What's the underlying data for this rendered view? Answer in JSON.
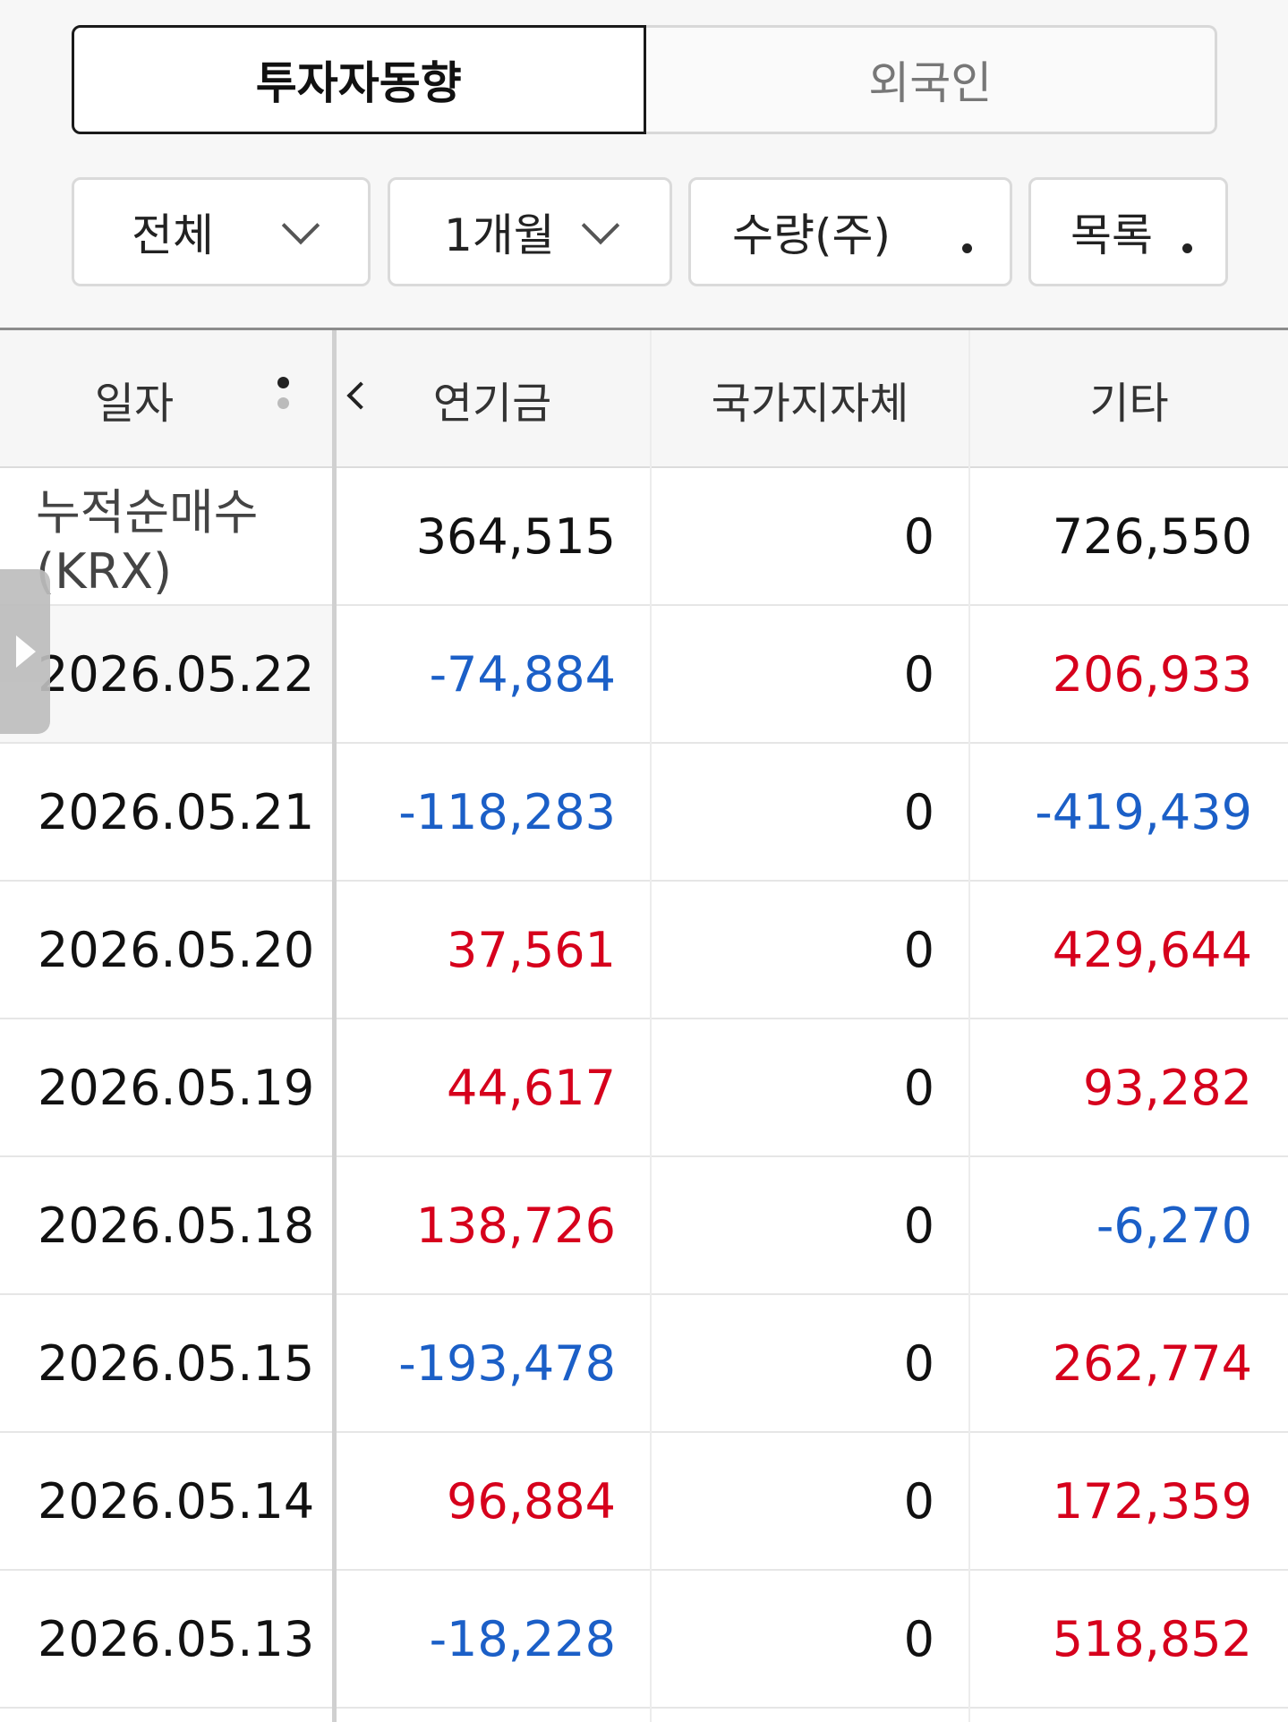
{
  "segment": {
    "active_label": "투자자동향",
    "inactive_label": "외국인"
  },
  "filters": {
    "scope": "전체",
    "period": "1개월",
    "unit": "수량(주)",
    "view": "목록"
  },
  "table": {
    "headers": {
      "date": "일자",
      "nps": "연기금",
      "gov": "국가지자체",
      "etc": "기타"
    },
    "summary": {
      "label": "누적순매수(KRX)",
      "nps": "364,515",
      "gov": "0",
      "etc": "726,550"
    },
    "rows": [
      {
        "date": "2026.05.22",
        "nps": "-74,884",
        "gov": "0",
        "etc": "206,933"
      },
      {
        "date": "2026.05.21",
        "nps": "-118,283",
        "gov": "0",
        "etc": "-419,439"
      },
      {
        "date": "2026.05.20",
        "nps": "37,561",
        "gov": "0",
        "etc": "429,644"
      },
      {
        "date": "2026.05.19",
        "nps": "44,617",
        "gov": "0",
        "etc": "93,282"
      },
      {
        "date": "2026.05.18",
        "nps": "138,726",
        "gov": "0",
        "etc": "-6,270"
      },
      {
        "date": "2026.05.15",
        "nps": "-193,478",
        "gov": "0",
        "etc": "262,774"
      },
      {
        "date": "2026.05.14",
        "nps": "96,884",
        "gov": "0",
        "etc": "172,359"
      },
      {
        "date": "2026.05.13",
        "nps": "-18,228",
        "gov": "0",
        "etc": "518,852"
      }
    ]
  },
  "colors": {
    "positive": "#d6001c",
    "negative": "#1b5fc7",
    "neutral": "#111111"
  },
  "icons": {
    "filter_dropdown": "chevron-down-icon",
    "filter_options": "more-vertical-icon",
    "scroll_left": "chevron-left-icon",
    "side_panel": "triangle-right-icon"
  }
}
